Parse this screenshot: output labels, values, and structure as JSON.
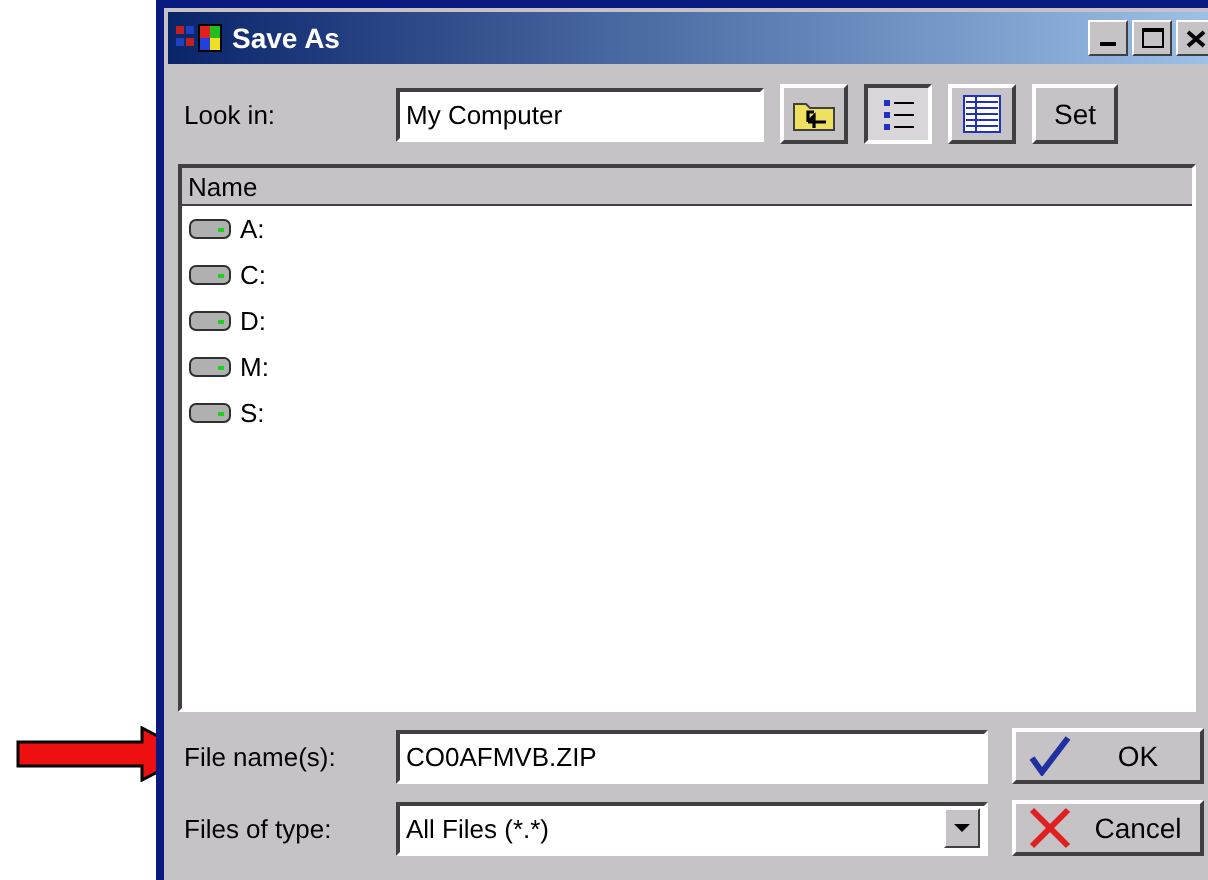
{
  "window": {
    "title": "Save As"
  },
  "look_in": {
    "label": "Look in:",
    "value": "My Computer"
  },
  "view_buttons": [
    {
      "kind": "up",
      "selected": false
    },
    {
      "kind": "list",
      "selected": true
    },
    {
      "kind": "details",
      "selected": false
    }
  ],
  "set_button": "Set",
  "list": {
    "column": "Name",
    "items": [
      {
        "label": "A:"
      },
      {
        "label": "C:"
      },
      {
        "label": "D:"
      },
      {
        "label": "M:"
      },
      {
        "label": "S:"
      }
    ]
  },
  "file_name": {
    "label": "File name(s):",
    "value": "CO0AFMVB.ZIP"
  },
  "file_type": {
    "label": "Files of type:",
    "value": "All Files (*.*)"
  },
  "buttons": [
    {
      "kind": "ok",
      "label": "OK"
    },
    {
      "kind": "cancel",
      "label": "Cancel"
    }
  ]
}
